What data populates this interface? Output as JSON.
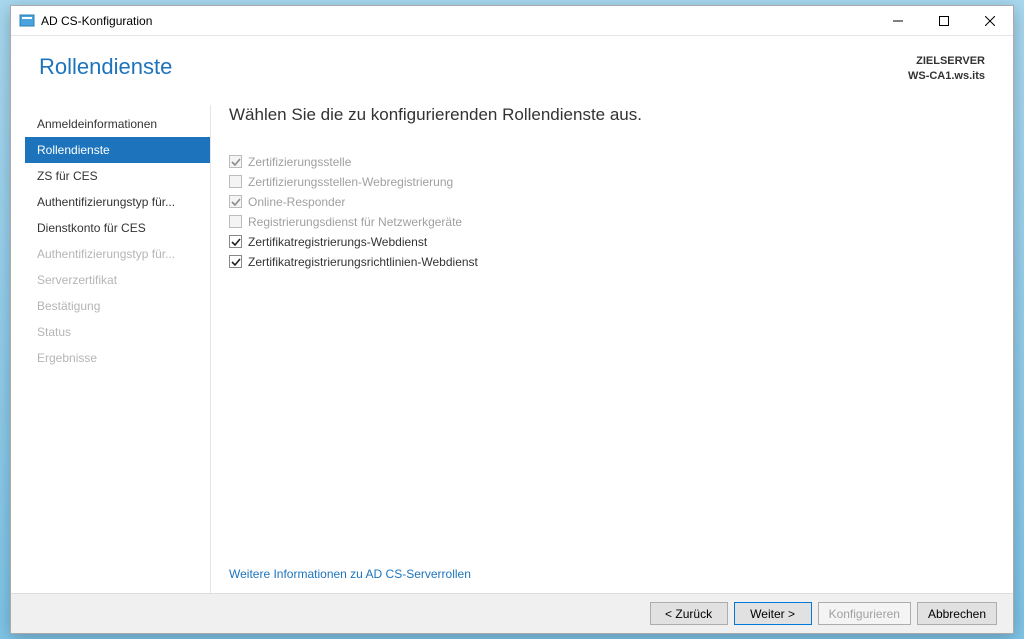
{
  "titlebar": {
    "title": "AD CS-Konfiguration"
  },
  "header": {
    "title": "Rollendienste",
    "target_label": "ZIELSERVER",
    "target_server": "WS-CA1.ws.its"
  },
  "sidebar": {
    "items": [
      {
        "label": "Anmeldeinformationen",
        "state": "normal"
      },
      {
        "label": "Rollendienste",
        "state": "selected"
      },
      {
        "label": "ZS für CES",
        "state": "normal"
      },
      {
        "label": "Authentifizierungstyp für...",
        "state": "normal"
      },
      {
        "label": "Dienstkonto für CES",
        "state": "normal"
      },
      {
        "label": "Authentifizierungstyp für...",
        "state": "disabled"
      },
      {
        "label": "Serverzertifikat",
        "state": "disabled"
      },
      {
        "label": "Bestätigung",
        "state": "disabled"
      },
      {
        "label": "Status",
        "state": "disabled"
      },
      {
        "label": "Ergebnisse",
        "state": "disabled"
      }
    ]
  },
  "content": {
    "heading": "Wählen Sie die zu konfigurierenden Rollendienste aus.",
    "options": [
      {
        "label": "Zertifizierungsstelle",
        "checked": true,
        "disabled": true
      },
      {
        "label": "Zertifizierungsstellen-Webregistrierung",
        "checked": false,
        "disabled": true
      },
      {
        "label": "Online-Responder",
        "checked": true,
        "disabled": true
      },
      {
        "label": "Registrierungsdienst für Netzwerkgeräte",
        "checked": false,
        "disabled": true
      },
      {
        "label": "Zertifikatregistrierungs-Webdienst",
        "checked": true,
        "disabled": false
      },
      {
        "label": "Zertifikatregistrierungsrichtlinien-Webdienst",
        "checked": true,
        "disabled": false
      }
    ],
    "link": "Weitere Informationen zu AD CS-Serverrollen"
  },
  "footer": {
    "back": "< Zurück",
    "next": "Weiter >",
    "configure": "Konfigurieren",
    "cancel": "Abbrechen"
  }
}
